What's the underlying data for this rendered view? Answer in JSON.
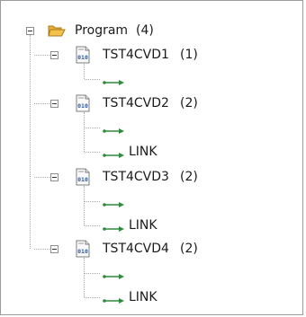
{
  "tree": {
    "root": {
      "label": "Program",
      "count": "(4)",
      "icon": "open-folder-icon"
    },
    "children": [
      {
        "label": "TST4CVD1",
        "count": "(1)",
        "icon": "binary-file-icon",
        "items": [
          {
            "icon": "arrow-icon",
            "label": ""
          }
        ]
      },
      {
        "label": "TST4CVD2",
        "count": "(2)",
        "icon": "binary-file-icon",
        "items": [
          {
            "icon": "arrow-icon",
            "label": ""
          },
          {
            "icon": "arrow-icon",
            "label": "LINK"
          }
        ]
      },
      {
        "label": "TST4CVD3",
        "count": "(2)",
        "icon": "binary-file-icon",
        "items": [
          {
            "icon": "arrow-icon",
            "label": ""
          },
          {
            "icon": "arrow-icon",
            "label": "LINK"
          }
        ]
      },
      {
        "label": "TST4CVD4",
        "count": "(2)",
        "icon": "binary-file-icon",
        "items": [
          {
            "icon": "arrow-icon",
            "label": ""
          },
          {
            "icon": "arrow-icon",
            "label": "LINK"
          }
        ]
      }
    ],
    "colors": {
      "arrow": "#2e8b3c",
      "folder": "#f2c24b",
      "bin_text": "#2b5aa8"
    }
  }
}
